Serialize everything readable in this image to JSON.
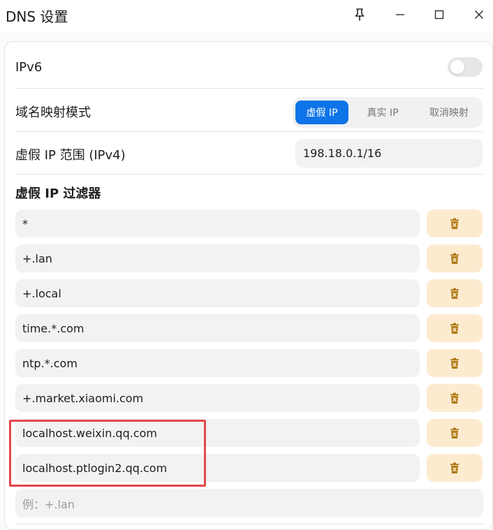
{
  "window": {
    "title": "DNS 设置",
    "controls": [
      "pin-icon",
      "minimize-icon",
      "maximize-icon",
      "close-icon"
    ]
  },
  "settings": {
    "ipv6": {
      "label": "IPv6",
      "enabled": false
    },
    "mapping_mode": {
      "label": "域名映射模式",
      "options": [
        "虚假 IP",
        "真实 IP",
        "取消映射"
      ],
      "selected": "虚假 IP"
    },
    "fake_ip_range": {
      "label": "虚假 IP 范围 (IPv4)",
      "value": "198.18.0.1/16"
    },
    "fake_ip_filter": {
      "title": "虚假 IP 过滤器",
      "items": [
        "*",
        "+.lan",
        "+.local",
        "time.*.com",
        "ntp.*.com",
        "+.market.xiaomi.com",
        "localhost.weixin.qq.com",
        "localhost.ptlogin2.qq.com"
      ],
      "delete_icon": "trash-icon",
      "new_entry_placeholder": "例：+.lan"
    }
  },
  "colors": {
    "accent": "#0f74e8",
    "delete_button_bg": "#fdebd0",
    "delete_icon": "#b07a16",
    "highlight": "#e5474b"
  }
}
